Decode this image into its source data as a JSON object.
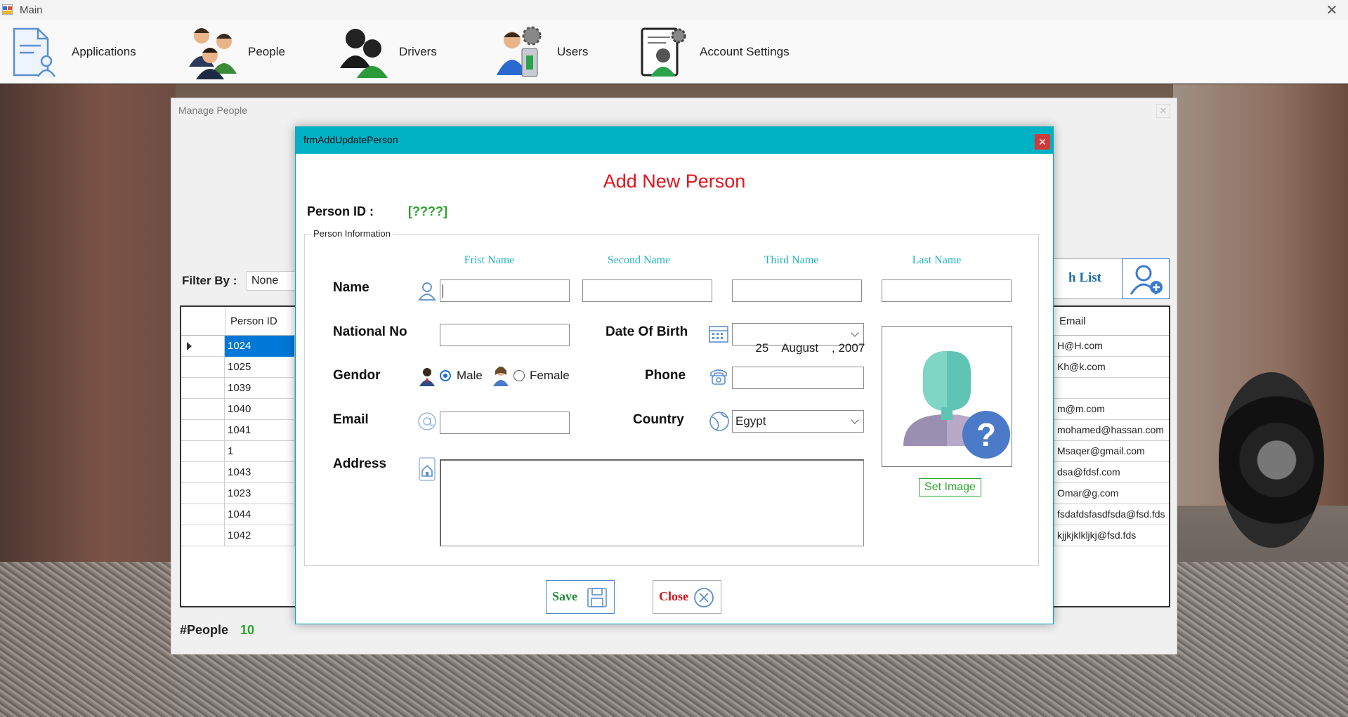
{
  "window": {
    "title": "Main"
  },
  "menu": {
    "items": [
      {
        "label": "Applications",
        "icon": "applications-document-icon"
      },
      {
        "label": "People",
        "icon": "people-group-icon"
      },
      {
        "label": "Drivers",
        "icon": "drivers-icon"
      },
      {
        "label": "Users",
        "icon": "users-gear-icon"
      },
      {
        "label": "Account Settings",
        "icon": "account-settings-icon"
      }
    ]
  },
  "manage_people": {
    "title": "Manage People",
    "filter_label": "Filter By :",
    "filter_value": "None",
    "show_list_label": "h List",
    "grid": {
      "headers": {
        "person_id": "Person ID",
        "email": "Email"
      },
      "rows": [
        {
          "id": "1024",
          "email": "H@H.com"
        },
        {
          "id": "1025",
          "email": "Kh@k.com"
        },
        {
          "id": "1039",
          "email": ""
        },
        {
          "id": "1040",
          "email": "m@m.com"
        },
        {
          "id": "1041",
          "email": "mohamed@hassan.com"
        },
        {
          "id": "1",
          "email": "Msaqer@gmail.com"
        },
        {
          "id": "1043",
          "email": "dsa@fdsf.com"
        },
        {
          "id": "1023",
          "email": "Omar@g.com"
        },
        {
          "id": "1044",
          "email": "fsdafdsfasdfsda@fsd.fds"
        },
        {
          "id": "1042",
          "email": "kjjkjklkljkj@fsd.fds"
        }
      ]
    },
    "people_count_label": "#People",
    "people_count": "10"
  },
  "dialog": {
    "title": "frmAddUpdatePerson",
    "heading": "Add New Person",
    "person_id_label": "Person ID :",
    "person_id_value": "[????]",
    "group_title": "Person Information",
    "column_headers": {
      "first": "Frist Name",
      "second": "Second Name",
      "third": "Third Name",
      "last": "Last Name"
    },
    "labels": {
      "name": "Name",
      "national_no": "National No",
      "date_of_birth": "Date Of Birth",
      "gender": "Gendor",
      "phone": "Phone",
      "email": "Email",
      "country": "Country",
      "address": "Address"
    },
    "gender": {
      "male": "Male",
      "female": "Female",
      "selected": "Male"
    },
    "date_of_birth": "25    August    , 2007",
    "country": "Egypt",
    "set_image": "Set Image",
    "save": "Save",
    "close": "Close"
  },
  "colors": {
    "dialog_title_bar": "#00b1c4",
    "heading_red": "#e0151f",
    "accent_green": "#2ba42b",
    "column_header_teal": "#22b3c0",
    "selection_blue": "#0078d7"
  }
}
